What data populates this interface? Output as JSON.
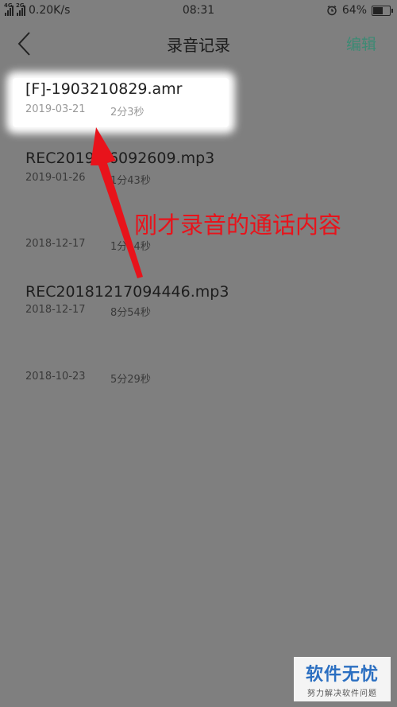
{
  "status_bar": {
    "signal1_label": "4G",
    "signal2_label": "2G",
    "speed": "0.20K/s",
    "time": "08:31",
    "alarm_icon": "alarm-clock-icon",
    "battery_percent": 64,
    "battery_text": "64%"
  },
  "nav": {
    "title": "录音记录",
    "edit_label": "编辑",
    "back_icon": "chevron-left-icon",
    "accent_color": "#3c8a74"
  },
  "recordings": [
    {
      "name": "[F]-1903210829.amr",
      "date": "2019-03-21",
      "duration": "2分3秒"
    },
    {
      "name": "REC2019  26092609.mp3",
      "date": "2019-01-26",
      "duration": "1分43秒"
    },
    {
      "name": "",
      "date": "2018-12-17",
      "duration": "1分14秒"
    },
    {
      "name": "REC20181217094446.mp3",
      "date": "2018-12-17",
      "duration": "8分54秒"
    },
    {
      "name": "",
      "date": "2018-10-23",
      "duration": "5分29秒"
    }
  ],
  "annotation": {
    "text": "刚才录音的通话内容",
    "color": "#e8131b"
  },
  "watermark": {
    "title": "软件无忧",
    "subtitle": "努力解决软件问题"
  }
}
